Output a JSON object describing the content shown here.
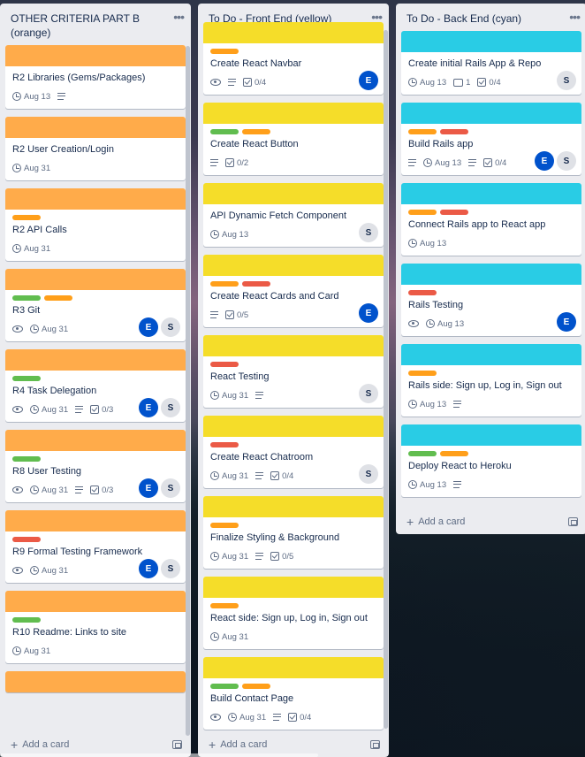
{
  "colors": {
    "orange": "#ffab4a",
    "yellow": "#f5dd29",
    "cyan": "#29cce5",
    "green": "#61bd4f",
    "label_orange": "#ff9f1a",
    "red": "#eb5a46",
    "avatar_e": "#0052cc"
  },
  "lists": [
    {
      "title": "OTHER CRITERIA PART B\n(orange)",
      "cover": "orange",
      "add_label": "Add a card",
      "cards": [
        {
          "title": "R2 Libraries (Gems/Packages)",
          "labels": [],
          "badges": [
            {
              "type": "clock",
              "text": "Aug 13"
            },
            {
              "type": "desc"
            }
          ],
          "members": []
        },
        {
          "title": "R2 User Creation/Login",
          "labels": [],
          "badges": [
            {
              "type": "clock",
              "text": "Aug 31"
            }
          ],
          "members": []
        },
        {
          "title": "R2 API Calls",
          "labels": [
            "label_orange"
          ],
          "badges": [
            {
              "type": "clock",
              "text": "Aug 31"
            }
          ],
          "members": []
        },
        {
          "title": "R3 Git",
          "labels": [
            "green",
            "label_orange"
          ],
          "badges": [
            {
              "type": "eye"
            },
            {
              "type": "clock",
              "text": "Aug 31"
            }
          ],
          "members": [
            "E",
            "S"
          ]
        },
        {
          "title": "R4 Task Delegation",
          "labels": [
            "green"
          ],
          "badges": [
            {
              "type": "eye"
            },
            {
              "type": "clock",
              "text": "Aug 31"
            },
            {
              "type": "desc"
            },
            {
              "type": "check",
              "text": "0/3"
            }
          ],
          "members": [
            "E",
            "S"
          ]
        },
        {
          "title": "R8 User Testing",
          "labels": [
            "green"
          ],
          "badges": [
            {
              "type": "eye"
            },
            {
              "type": "clock",
              "text": "Aug 31"
            },
            {
              "type": "desc"
            },
            {
              "type": "check",
              "text": "0/3"
            }
          ],
          "members": [
            "E",
            "S"
          ]
        },
        {
          "title": "R9 Formal Testing Framework",
          "labels": [
            "red"
          ],
          "badges": [
            {
              "type": "eye"
            },
            {
              "type": "clock",
              "text": "Aug 31"
            }
          ],
          "members": [
            "E",
            "S"
          ]
        },
        {
          "title": "R10 Readme: Links to site",
          "labels": [
            "green"
          ],
          "badges": [
            {
              "type": "clock",
              "text": "Aug 31"
            }
          ],
          "members": []
        },
        {
          "title": "",
          "labels": [],
          "badges": [],
          "members": []
        }
      ]
    },
    {
      "title": "To Do - Front End (yellow)",
      "cover": "yellow",
      "add_label": "Add a card",
      "cards": [
        {
          "title": "Create React Navbar",
          "labels": [
            "label_orange"
          ],
          "badges": [
            {
              "type": "eye"
            },
            {
              "type": "desc"
            },
            {
              "type": "check",
              "text": "0/4"
            }
          ],
          "members": [
            "E"
          ]
        },
        {
          "title": "Create React Button",
          "labels": [
            "green",
            "label_orange"
          ],
          "badges": [
            {
              "type": "desc"
            },
            {
              "type": "check",
              "text": "0/2"
            }
          ],
          "members": []
        },
        {
          "title": "API Dynamic Fetch Component",
          "labels": [],
          "badges": [
            {
              "type": "clock",
              "text": "Aug 13"
            }
          ],
          "members": [
            "S"
          ]
        },
        {
          "title": "Create React Cards and Card",
          "labels": [
            "label_orange",
            "red"
          ],
          "badges": [
            {
              "type": "desc"
            },
            {
              "type": "check",
              "text": "0/5"
            }
          ],
          "members": [
            "E"
          ]
        },
        {
          "title": "React Testing",
          "labels": [
            "red"
          ],
          "badges": [
            {
              "type": "clock",
              "text": "Aug 31"
            },
            {
              "type": "desc"
            }
          ],
          "members": [
            "S"
          ]
        },
        {
          "title": "Create React Chatroom",
          "labels": [
            "red"
          ],
          "badges": [
            {
              "type": "clock",
              "text": "Aug 31"
            },
            {
              "type": "desc"
            },
            {
              "type": "check",
              "text": "0/4"
            }
          ],
          "members": [
            "S"
          ]
        },
        {
          "title": "Finalize Styling & Background",
          "labels": [
            "label_orange"
          ],
          "badges": [
            {
              "type": "clock",
              "text": "Aug 31"
            },
            {
              "type": "desc"
            },
            {
              "type": "check",
              "text": "0/5"
            }
          ],
          "members": []
        },
        {
          "title": "React side: Sign up, Log in, Sign out",
          "labels": [
            "label_orange"
          ],
          "badges": [
            {
              "type": "clock",
              "text": "Aug 31"
            }
          ],
          "members": []
        },
        {
          "title": "Build Contact Page",
          "labels": [
            "green",
            "label_orange"
          ],
          "badges": [
            {
              "type": "eye"
            },
            {
              "type": "clock",
              "text": "Aug 31"
            },
            {
              "type": "desc"
            },
            {
              "type": "check",
              "text": "0/4"
            }
          ],
          "members": []
        }
      ]
    },
    {
      "title": "To Do - Back End (cyan)",
      "cover": "cyan",
      "add_label": "Add a card",
      "cards": [
        {
          "title": "Create initial Rails App & Repo",
          "labels": [],
          "badges": [
            {
              "type": "clock",
              "text": "Aug 13"
            },
            {
              "type": "comment",
              "text": "1"
            },
            {
              "type": "check",
              "text": "0/4"
            }
          ],
          "members": [
            "S"
          ]
        },
        {
          "title": "Build Rails app",
          "labels": [
            "label_orange",
            "red"
          ],
          "badges": [
            {
              "type": "desc"
            },
            {
              "type": "clock",
              "text": "Aug 13"
            },
            {
              "type": "desc"
            },
            {
              "type": "check",
              "text": "0/4"
            }
          ],
          "members": [
            "E",
            "S"
          ]
        },
        {
          "title": "Connect Rails app to React app",
          "labels": [
            "label_orange",
            "red"
          ],
          "badges": [
            {
              "type": "clock",
              "text": "Aug 13"
            }
          ],
          "members": []
        },
        {
          "title": "Rails Testing",
          "labels": [
            "red"
          ],
          "badges": [
            {
              "type": "eye"
            },
            {
              "type": "clock",
              "text": "Aug 13"
            }
          ],
          "members": [
            "E"
          ]
        },
        {
          "title": "Rails side: Sign up, Log in, Sign out",
          "labels": [
            "label_orange"
          ],
          "badges": [
            {
              "type": "clock",
              "text": "Aug 13"
            },
            {
              "type": "desc"
            }
          ],
          "members": []
        },
        {
          "title": "Deploy React to Heroku",
          "labels": [
            "green",
            "label_orange"
          ],
          "badges": [
            {
              "type": "clock",
              "text": "Aug 13"
            },
            {
              "type": "desc"
            }
          ],
          "members": []
        }
      ]
    }
  ]
}
